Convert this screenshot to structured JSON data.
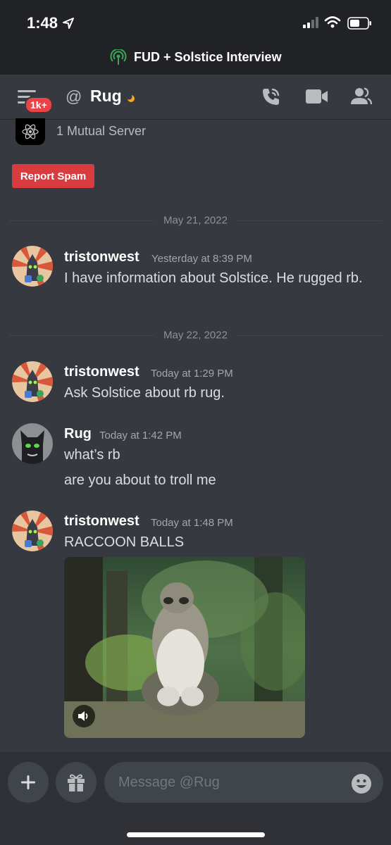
{
  "status_bar": {
    "time": "1:48"
  },
  "call_banner": {
    "title": "FUD + Solstice Interview"
  },
  "header": {
    "badge": "1k+",
    "at_symbol": "@",
    "channel_name": "Rug"
  },
  "profile": {
    "mutual_servers": "1 Mutual Server",
    "report_label": "Report Spam"
  },
  "dividers": [
    "May 21, 2022",
    "May 22, 2022"
  ],
  "messages": [
    {
      "author": "tristonwest",
      "time": "Yesterday at 8:39 PM",
      "lines": [
        "I have information about Solstice. He rugged rb."
      ]
    },
    {
      "author": "tristonwest",
      "time": "Today at 1:29 PM",
      "lines": [
        "Ask Solstice about rb rug."
      ]
    },
    {
      "author": "Rug",
      "time": "Today at 1:42 PM",
      "lines": [
        "what’s rb",
        "are you about to troll me"
      ]
    },
    {
      "author": "tristonwest",
      "time": "Today at 1:48 PM",
      "lines": [
        "RACCOON BALLS"
      ]
    }
  ],
  "composer": {
    "placeholder": "Message @Rug"
  },
  "icons": {
    "status_location": "location-arrow-icon",
    "status_signal": "cellular-signal-icon",
    "status_wifi": "wifi-icon",
    "status_battery": "battery-icon",
    "call": "voice-connected-icon",
    "menu": "hamburger-menu-icon",
    "idle": "moon-icon",
    "voice_call": "phone-call-icon",
    "video": "video-camera-icon",
    "members": "members-icon",
    "server": "atom-icon",
    "volume": "speaker-icon",
    "add": "plus-icon",
    "gift": "gift-icon",
    "emoji": "smile-icon"
  },
  "colors": {
    "background": "#36393f",
    "bars": "#202225",
    "report": "#d83c3e",
    "badge": "#ed4245",
    "call_green": "#3ba55c",
    "idle": "#faa81a"
  }
}
